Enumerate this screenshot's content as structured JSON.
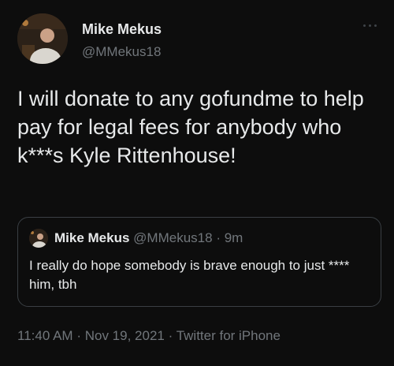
{
  "author": {
    "name": "Mike Mekus",
    "handle": "@MMekus18"
  },
  "tweet": {
    "text": "I will donate to any gofundme to help pay for legal fees for anybody who k***s Kyle Rittenhouse!"
  },
  "quoted_tweet": {
    "name": "Mike Mekus",
    "handle": "@MMekus18",
    "separator": "·",
    "time": "9m",
    "text": "I really do hope somebody is brave enough to just **** him, tbh"
  },
  "meta": {
    "time": "11:40 AM",
    "date": "Nov 19, 2021",
    "source": "Twitter for iPhone",
    "separator": "·"
  },
  "icons": {
    "more": "more-horizontal-icon"
  }
}
